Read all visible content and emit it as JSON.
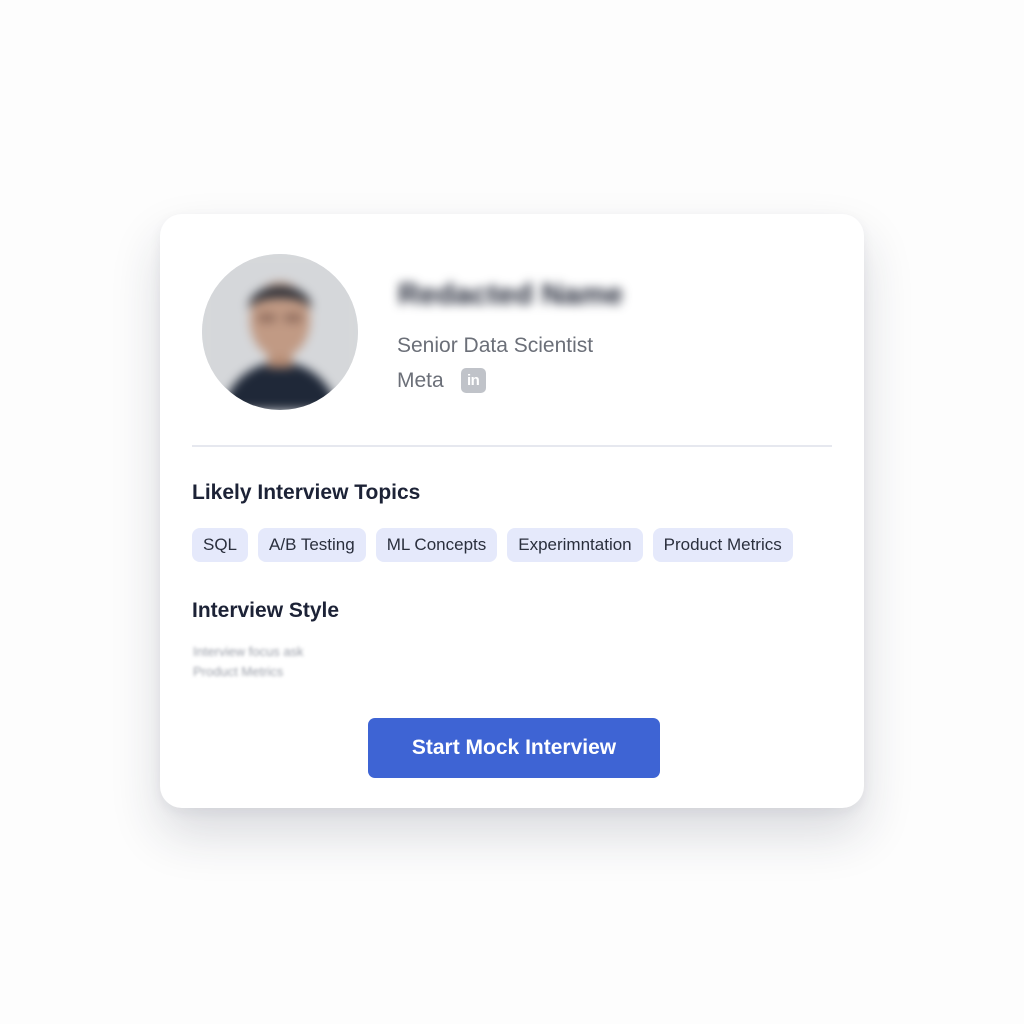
{
  "profile": {
    "name": "Redacted Name",
    "title": "Senior Data Scientist",
    "company": "Meta",
    "linkedin_icon": "linkedin-icon",
    "linkedin_label": "in"
  },
  "topics": {
    "heading": "Likely Interview Topics",
    "items": [
      "SQL",
      "A/B Testing",
      "ML Concepts",
      "Experimntation",
      "Product Metrics"
    ]
  },
  "interview_style": {
    "heading": "Interview Style",
    "lines": [
      "Interview focus ask",
      "Product Metrics"
    ]
  },
  "actions": {
    "start_label": "Start Mock Interview"
  },
  "colors": {
    "accent": "#3e64d4",
    "chip_bg": "#e5e9fb",
    "heading": "#1c2236",
    "muted_text": "#6b6f78"
  }
}
